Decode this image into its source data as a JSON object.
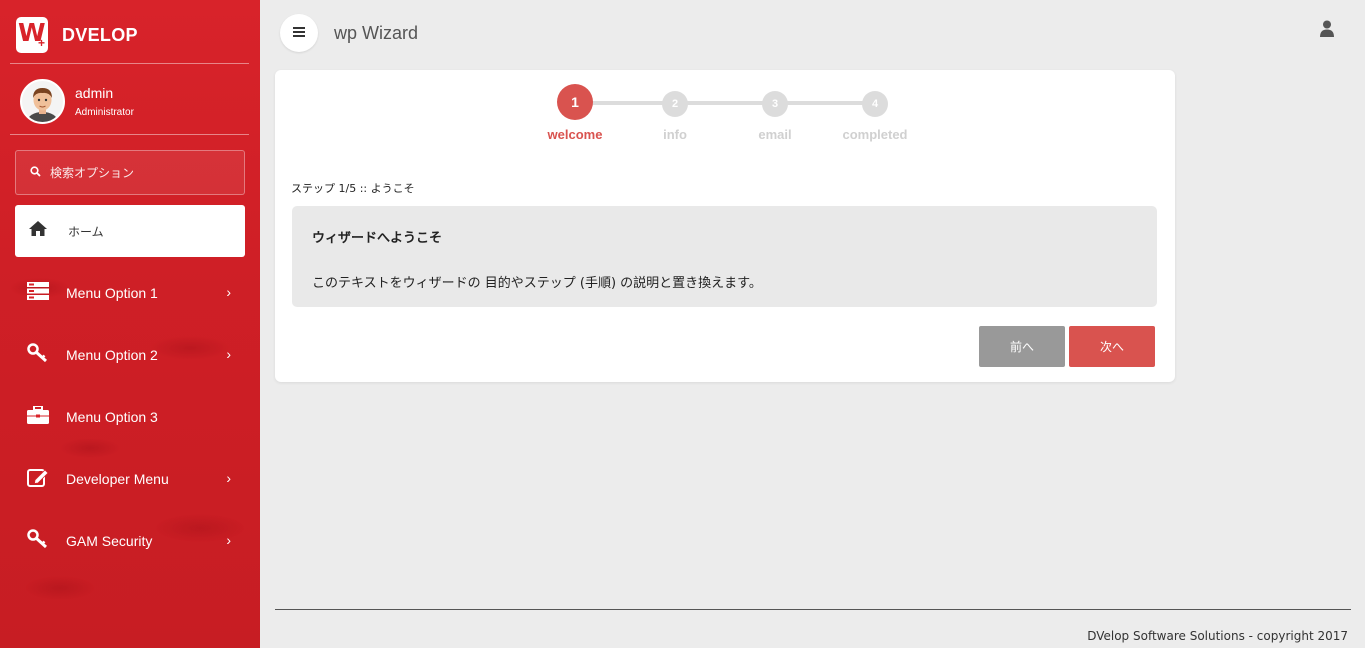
{
  "sidebar": {
    "brand": "DVELOP",
    "logo_letter": "W",
    "user": {
      "name": "admin",
      "role": "Administrator"
    },
    "search_placeholder": "検索オプション",
    "home_label": "ホーム",
    "items": [
      {
        "label": "Menu Option 1",
        "icon": "server-icon",
        "has_submenu": true
      },
      {
        "label": "Menu Option 2",
        "icon": "key-icon",
        "has_submenu": true
      },
      {
        "label": "Menu Option 3",
        "icon": "briefcase-icon",
        "has_submenu": false
      },
      {
        "label": "Developer Menu",
        "icon": "edit-icon",
        "has_submenu": true
      },
      {
        "label": "GAM Security",
        "icon": "key-icon",
        "has_submenu": true
      }
    ],
    "chevron": "›"
  },
  "header": {
    "title": "wp Wizard"
  },
  "wizard": {
    "steps": [
      {
        "number": "1",
        "label": "welcome",
        "active": true
      },
      {
        "number": "2",
        "label": "info",
        "active": false
      },
      {
        "number": "3",
        "label": "email",
        "active": false
      },
      {
        "number": "4",
        "label": "completed",
        "active": false
      }
    ],
    "caption": "ステップ 1/5 :: ようこそ",
    "well_title": "ウィザードへようこそ",
    "well_body": "このテキストをウィザードの 目的やステップ (手順) の説明と置き換えます。",
    "prev_label": "前へ",
    "next_label": "次へ"
  },
  "footer": {
    "text": "DVelop Software Solutions - copyright 2017"
  },
  "colors": {
    "sidebar": "#d8232a",
    "accent": "#d9534f",
    "prev_button": "#999999"
  }
}
